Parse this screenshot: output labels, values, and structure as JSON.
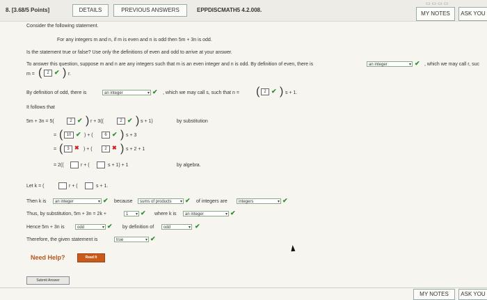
{
  "header": {
    "question_number": "8.  [3.68/5 Points]",
    "details_label": "DETAILS",
    "previous_answers_label": "PREVIOUS ANSWERS",
    "question_id": "EPPDISCMATH5 4.2.008.",
    "my_notes_label": "MY NOTES",
    "ask_label": "ASK YOU"
  },
  "content": {
    "intro": "Consider the following statement.",
    "statement": "For any integers m and n, if m is even and n is odd then 5m + 3n is odd.",
    "question": "Is the statement true or false? Use only the definitions of even and odd to arrive at your answer.",
    "instruction_a": "To answer this question, suppose m and n are any integers such that m is an even integer and n is odd. By definition of even, there is",
    "instruction_sel": "an integer",
    "instruction_tail": ", which we may call r, suc",
    "m_eq": "m =",
    "m_box": "2",
    "odd_def_a": "By definition of odd, there is",
    "odd_def_sel": "an integer",
    "odd_def_b": ", which we may call s, such that n =",
    "n_box": "2",
    "n_tail": "s + 1.",
    "follows": "It follows that",
    "l1_lhs": "5m + 3n  =  5(",
    "l1_box1": "2",
    "l1_mid": "r + 3((",
    "l1_box2": "2",
    "l1_tail": "s + 1)",
    "l1_reason": "by substitution",
    "l2_eq": "=",
    "l2_box1": "10",
    "l2_box2": "6",
    "l2_tail": "s + 3",
    "l3_eq": "=",
    "l3_box1": "3",
    "l3_box2": "2",
    "l3_tail": "s + 2 + 1",
    "l4_eq": "=  2((",
    "l4_mid": "r + (",
    "l4_tail": "s + 1) + 1",
    "l4_reason": "by algebra.",
    "let_k": "Let k = (",
    "let_mid": "r + (",
    "let_tail": "s + 1.",
    "then_a": "Then k is",
    "then_sel": "an integer",
    "then_b": "because",
    "then_sel2": "sums of products",
    "then_c": "of integers are",
    "then_sel3": "integers",
    "thus_a": "Thus, by substitution, 5m + 3n = 2k +",
    "thus_sel": "1",
    "thus_b": "where k is",
    "thus_sel2": "an integer",
    "hence_a": "Hence 5m + 3n is",
    "hence_sel": "odd",
    "hence_b": "by definition of",
    "hence_sel2": "odd",
    "therefore_a": "Therefore, the given statement is",
    "therefore_sel": "true",
    "need_help": "Need Help?",
    "read_it": "Read It",
    "submit_answer": "Submit Answer"
  },
  "footer": {
    "my_notes_label": "MY NOTES",
    "ask_label": "ASK YOU"
  },
  "colors": {
    "check": "#2e8b2e",
    "cross": "#c22222",
    "read_it": "#c85a1c"
  }
}
